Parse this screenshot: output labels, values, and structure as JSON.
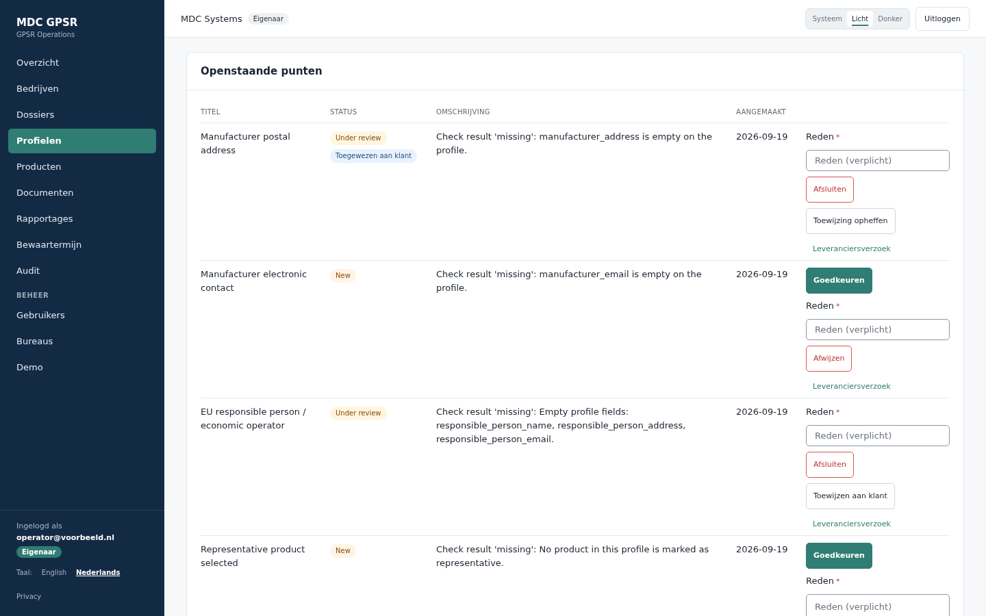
{
  "sidebar": {
    "brand": "MDC GPSR",
    "subtitle": "GPSR Operations",
    "nav": [
      {
        "label": "Overzicht",
        "selected": false
      },
      {
        "label": "Bedrijven",
        "selected": false
      },
      {
        "label": "Dossiers",
        "selected": false
      },
      {
        "label": "Profielen",
        "selected": true
      },
      {
        "label": "Producten",
        "selected": false
      },
      {
        "label": "Documenten",
        "selected": false
      },
      {
        "label": "Rapportages",
        "selected": false
      },
      {
        "label": "Bewaartermijn",
        "selected": false
      },
      {
        "label": "Audit",
        "selected": false
      }
    ],
    "section_heading": "BEHEER",
    "admin_nav": [
      {
        "label": "Gebruikers",
        "selected": false
      },
      {
        "label": "Bureaus",
        "selected": false
      },
      {
        "label": "Demo",
        "selected": false
      }
    ],
    "logged_in_label": "Ingelogd als",
    "user_email": "operator@voorbeeld.nl",
    "role_badge": "Eigenaar",
    "language_label": "Taal:",
    "languages": [
      {
        "label": "English",
        "selected": false
      },
      {
        "label": "Nederlands",
        "selected": true
      }
    ],
    "privacy_link": "Privacy"
  },
  "header": {
    "organization": "MDC Systems",
    "role_badge": "Eigenaar",
    "theme_options": [
      {
        "label": "Systeem",
        "selected": false
      },
      {
        "label": "Licht",
        "selected": true
      },
      {
        "label": "Donker",
        "selected": false
      }
    ],
    "logout_button": "Uitloggen"
  },
  "card": {
    "title": "Openstaande punten",
    "columns": [
      "TITEL",
      "STATUS",
      "OMSCHRIJVING",
      "AANGEMAAKT"
    ],
    "rows": [
      {
        "title": "Manufacturer postal address",
        "statuses": [
          {
            "label": "Under review",
            "kind": "review"
          },
          {
            "label": "Toegewezen aan klant",
            "kind": "assigned"
          }
        ],
        "description": "Check result 'missing': manufacturer_address is empty on the profile.",
        "created": "2026-09-19",
        "actions": [
          {
            "kind": "label",
            "text": "Reden",
            "required_mark": "*"
          },
          {
            "kind": "input",
            "placeholder": "Reden (verplicht)"
          },
          {
            "kind": "danger",
            "text": "Afsluiten"
          },
          {
            "kind": "neutral",
            "text": "Toewijzing opheffen"
          },
          {
            "kind": "link",
            "text": "Leveranciersverzoek"
          }
        ]
      },
      {
        "title": "Manufacturer electronic contact",
        "statuses": [
          {
            "label": "New",
            "kind": "new"
          }
        ],
        "description": "Check result 'missing': manufacturer_email is empty on the profile.",
        "created": "2026-09-19",
        "actions": [
          {
            "kind": "primary",
            "text": "Goedkeuren"
          },
          {
            "kind": "label",
            "text": "Reden",
            "required_mark": "*"
          },
          {
            "kind": "input",
            "placeholder": "Reden (verplicht)"
          },
          {
            "kind": "danger",
            "text": "Afwijzen"
          },
          {
            "kind": "link",
            "text": "Leveranciersverzoek"
          }
        ]
      },
      {
        "title": "EU responsible person / economic operator",
        "statuses": [
          {
            "label": "Under review",
            "kind": "review"
          }
        ],
        "description": "Check result 'missing': Empty profile fields: responsible_person_name, responsible_person_address, responsible_person_email.",
        "created": "2026-09-19",
        "actions": [
          {
            "kind": "label",
            "text": "Reden",
            "required_mark": "*"
          },
          {
            "kind": "input",
            "placeholder": "Reden (verplicht)"
          },
          {
            "kind": "danger",
            "text": "Afsluiten"
          },
          {
            "kind": "neutral",
            "text": "Toewijzen aan klant"
          },
          {
            "kind": "link",
            "text": "Leveranciersverzoek"
          }
        ]
      },
      {
        "title": "Representative product selected",
        "statuses": [
          {
            "label": "New",
            "kind": "new"
          }
        ],
        "description": "Check result 'missing': No product in this profile is marked as representative.",
        "created": "2026-09-19",
        "actions": [
          {
            "kind": "primary",
            "text": "Goedkeuren"
          },
          {
            "kind": "label",
            "text": "Reden",
            "required_mark": "*"
          },
          {
            "kind": "input",
            "placeholder": "Reden (verplicht)"
          }
        ]
      }
    ]
  }
}
